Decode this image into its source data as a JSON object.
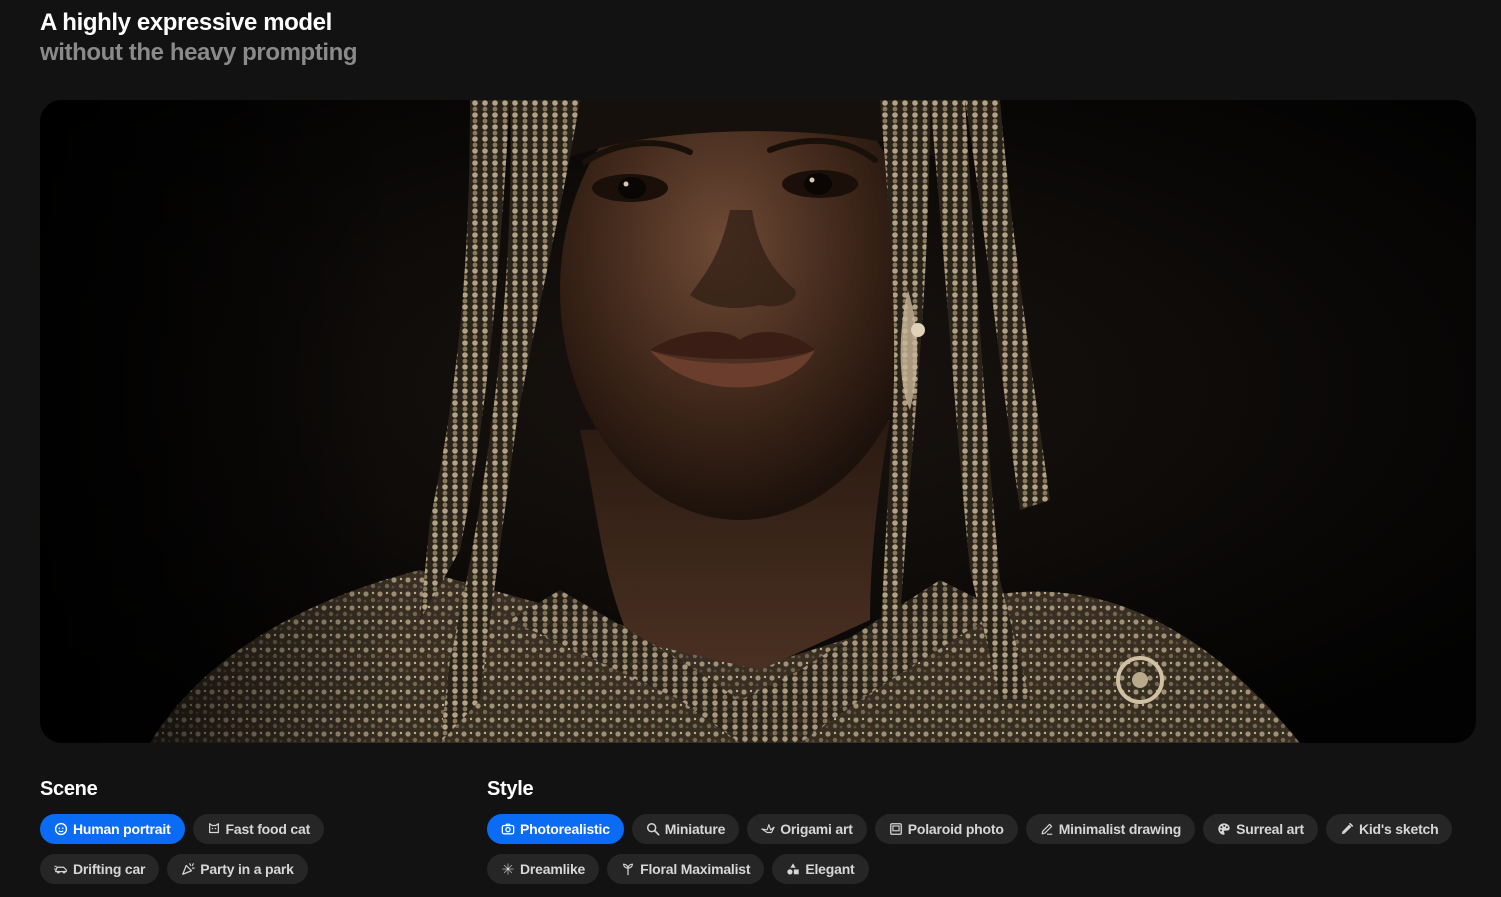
{
  "header": {
    "title": "A highly expressive model",
    "subtitle": "without the heavy prompting"
  },
  "hero": {
    "image_alt": "Portrait of a woman wearing an ornate beaded golden headdress against a dark background"
  },
  "scene": {
    "title": "Scene",
    "chips": [
      {
        "label": "Human portrait",
        "icon": "face-icon",
        "active": true
      },
      {
        "label": "Fast food cat",
        "icon": "cat-icon",
        "active": false
      },
      {
        "label": "Drifting car",
        "icon": "car-icon",
        "active": false
      },
      {
        "label": "Party in a park",
        "icon": "party-icon",
        "active": false
      }
    ]
  },
  "style": {
    "title": "Style",
    "chips": [
      {
        "label": "Photorealistic",
        "icon": "camera-icon",
        "active": true
      },
      {
        "label": "Miniature",
        "icon": "magnifier-icon",
        "active": false
      },
      {
        "label": "Origami art",
        "icon": "origami-bird-icon",
        "active": false
      },
      {
        "label": "Polaroid photo",
        "icon": "polaroid-icon",
        "active": false
      },
      {
        "label": "Minimalist drawing",
        "icon": "pencil-icon",
        "active": false
      },
      {
        "label": "Surreal art",
        "icon": "palette-icon",
        "active": false
      },
      {
        "label": "Kid's sketch",
        "icon": "crayon-icon",
        "active": false
      },
      {
        "label": "Dreamlike",
        "icon": "sparkle-icon",
        "active": false
      },
      {
        "label": "Floral Maximalist",
        "icon": "flower-icon",
        "active": false
      },
      {
        "label": "Elegant",
        "icon": "shapes-icon",
        "active": false
      }
    ]
  },
  "colors": {
    "background": "#121212",
    "chip": "#262626",
    "chip_active": "#0a6cf5"
  }
}
